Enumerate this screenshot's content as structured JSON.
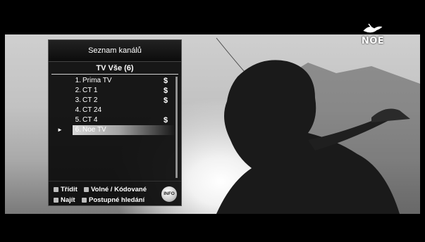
{
  "channel_logo": {
    "text": "NOE"
  },
  "menu": {
    "title": "Seznam kanálů",
    "group": "TV Vše (6)",
    "channels": [
      {
        "number": "1.",
        "name": "Prima TV",
        "paid": "$"
      },
      {
        "number": "2.",
        "name": "CT 1",
        "paid": "$"
      },
      {
        "number": "3.",
        "name": "CT 2",
        "paid": "$"
      },
      {
        "number": "4.",
        "name": "CT 24",
        "paid": ""
      },
      {
        "number": "5.",
        "name": "CT 4",
        "paid": "$"
      },
      {
        "number": "6.",
        "name": "Noe TV",
        "paid": ""
      }
    ],
    "selected_index": 5,
    "selection_marker": "►",
    "footer": {
      "sort_label": "Třídit",
      "free_scrambled_label": "Volné / Kódované",
      "find_label": "Najít",
      "progressive_search_label": "Postupné hledání",
      "info_label": "INFO"
    }
  },
  "colors": {
    "background": "#000000",
    "panel": "#0a0a0a",
    "text": "#ffffff",
    "highlight": "#d8d8d8"
  }
}
